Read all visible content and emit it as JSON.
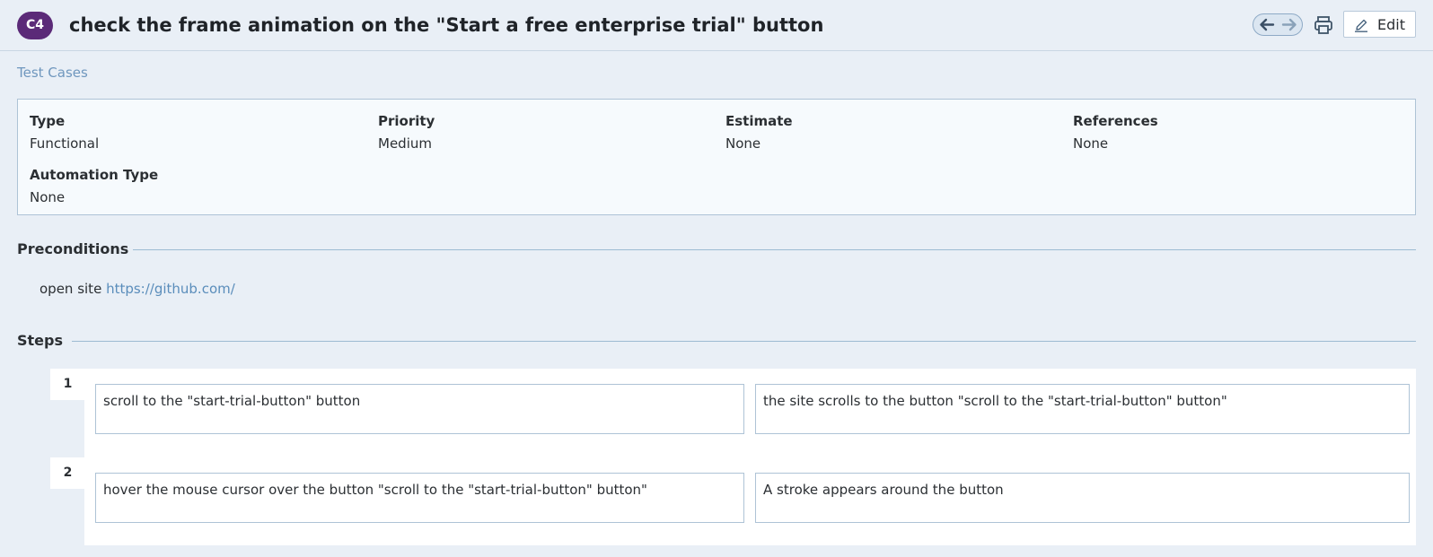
{
  "header": {
    "case_id": "C4",
    "title": "check the frame animation on the \"Start a free enterprise trial\" button",
    "edit_label": "Edit",
    "icons": [
      "arrow-left-icon",
      "arrow-right-icon",
      "printer-icon",
      "pencil-icon"
    ]
  },
  "breadcrumb": "Test Cases",
  "fields": {
    "type": {
      "label": "Type",
      "value": "Functional"
    },
    "priority": {
      "label": "Priority",
      "value": "Medium"
    },
    "estimate": {
      "label": "Estimate",
      "value": "None"
    },
    "references": {
      "label": "References",
      "value": "None"
    },
    "automation_type": {
      "label": "Automation Type",
      "value": "None"
    }
  },
  "preconditions": {
    "heading": "Preconditions",
    "text": "open site ",
    "link": "https://github.com/"
  },
  "steps": {
    "heading": "Steps",
    "items": [
      {
        "number": "1",
        "action": "scroll to the \"start-trial-button\" button",
        "expected": "the site scrolls to the button \"scroll to the \"start-trial-button\" button\""
      },
      {
        "number": "2",
        "action": "hover the mouse cursor over the button \"scroll to the \"start-trial-button\" button\"",
        "expected": "A stroke appears around the button"
      }
    ]
  },
  "colors": {
    "badge": "#5b2a78",
    "background": "#e9eff6",
    "link": "#5a8dbb"
  }
}
